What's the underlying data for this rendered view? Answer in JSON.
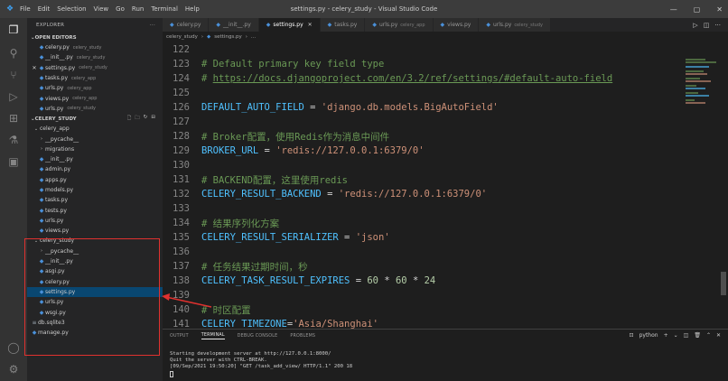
{
  "titlebar": {
    "menu": [
      "File",
      "Edit",
      "Selection",
      "View",
      "Go",
      "Run",
      "Terminal",
      "Help"
    ],
    "title": "settings.py - celery_study - Visual Studio Code"
  },
  "explorer": {
    "header": "EXPLORER",
    "open_editors_label": "OPEN EDITORS",
    "open_editors": [
      {
        "name": "celery.py",
        "desc": "celery_study"
      },
      {
        "name": "__init__.py",
        "desc": "celery_study"
      },
      {
        "name": "settings.py",
        "desc": "celery_study"
      },
      {
        "name": "tasks.py",
        "desc": "celery_app"
      },
      {
        "name": "urls.py",
        "desc": "celery_app"
      },
      {
        "name": "views.py",
        "desc": "celery_app"
      },
      {
        "name": "urls.py",
        "desc": "celery_study"
      }
    ],
    "project_label": "CELERY_STUDY",
    "tree": [
      {
        "name": "celery_app"
      },
      {
        "name": "__pycache__"
      },
      {
        "name": "migrations"
      },
      {
        "name": "__init__.py"
      },
      {
        "name": "admin.py"
      },
      {
        "name": "apps.py"
      },
      {
        "name": "models.py"
      },
      {
        "name": "tasks.py"
      },
      {
        "name": "tests.py"
      },
      {
        "name": "urls.py"
      },
      {
        "name": "views.py"
      },
      {
        "name": "celery_study"
      },
      {
        "name": "__pycache__"
      },
      {
        "name": "__init__.py"
      },
      {
        "name": "asgi.py"
      },
      {
        "name": "celery.py"
      },
      {
        "name": "settings.py"
      },
      {
        "name": "urls.py"
      },
      {
        "name": "wsgi.py"
      },
      {
        "name": "db.sqlite3"
      },
      {
        "name": "manage.py"
      }
    ]
  },
  "tabs": [
    {
      "name": "celery.py",
      "desc": ""
    },
    {
      "name": "__init__.py",
      "desc": ""
    },
    {
      "name": "settings.py",
      "desc": ""
    },
    {
      "name": "tasks.py",
      "desc": ""
    },
    {
      "name": "urls.py",
      "desc": "celery_app"
    },
    {
      "name": "views.py",
      "desc": ""
    },
    {
      "name": "urls.py",
      "desc": "celery_study"
    }
  ],
  "breadcrumb": {
    "folder": "celery_study",
    "file": "settings.py",
    "tail": "..."
  },
  "code": {
    "lines": [
      {
        "n": "122"
      },
      {
        "n": "123",
        "comment": "# Default primary key field type"
      },
      {
        "n": "124",
        "hash": "# ",
        "link": "https://docs.djangoproject.com/en/3.2/ref/settings/#default-auto-field"
      },
      {
        "n": "125"
      },
      {
        "n": "126",
        "var": "DEFAULT_AUTO_FIELD",
        "op": " = ",
        "str": "'django.db.models.BigAutoField'"
      },
      {
        "n": "127"
      },
      {
        "n": "128",
        "comment": "# Broker配置，使用Redis作为消息中间件"
      },
      {
        "n": "129",
        "var": "BROKER_URL",
        "op": " = ",
        "str": "'redis://127.0.0.1:6379/0'"
      },
      {
        "n": "130"
      },
      {
        "n": "131",
        "comment": "# BACKEND配置，这里使用redis"
      },
      {
        "n": "132",
        "var": "CELERY_RESULT_BACKEND",
        "op": " = ",
        "str": "'redis://127.0.0.1:6379/0'"
      },
      {
        "n": "133"
      },
      {
        "n": "134",
        "comment": "# 结果序列化方案"
      },
      {
        "n": "135",
        "var": "CELERY_RESULT_SERIALIZER",
        "op": " = ",
        "str": "'json'"
      },
      {
        "n": "136"
      },
      {
        "n": "137",
        "comment": "# 任务结果过期时间，秒"
      },
      {
        "n": "138",
        "var": "CELERY_TASK_RESULT_EXPIRES",
        "op": " = ",
        "num1": "60",
        "op2": " * ",
        "num2": "60",
        "op3": " * ",
        "num3": "24"
      },
      {
        "n": "139"
      },
      {
        "n": "140",
        "comment": "# 时区配置"
      },
      {
        "n": "141",
        "var": "CELERY_TIMEZONE",
        "op": "=",
        "str": "'Asia/Shanghai'"
      }
    ]
  },
  "panel": {
    "tabs": [
      "OUTPUT",
      "TERMINAL",
      "DEBUG CONSOLE",
      "PROBLEMS"
    ],
    "active_tab": "TERMINAL",
    "shell": "python",
    "terminal_lines": [
      "Starting development server at http://127.0.0.1:8000/",
      "Quit the server with CTRL-BREAK.",
      "[09/Sep/2021 19:50:20] \"GET /task_add_view/ HTTP/1.1\" 200 18"
    ]
  },
  "colors": {
    "highlight_box": "#e0312f",
    "selected_row": "#094771",
    "keyword_var": "#4fc1ff",
    "string": "#ce9178",
    "comment": "#6a9955"
  }
}
